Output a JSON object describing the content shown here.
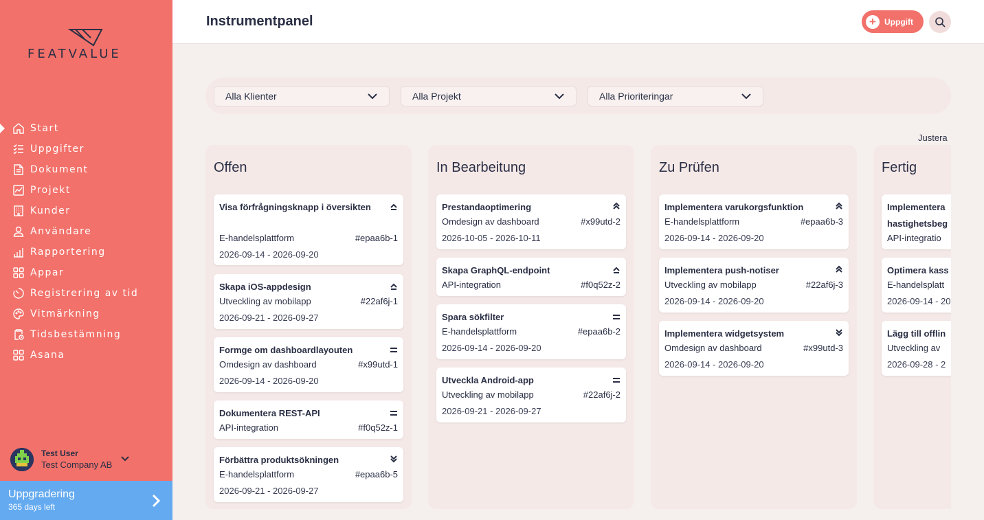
{
  "brand": {
    "name": "FEATVALUE",
    "colors": {
      "primary": "#f2716a",
      "accent": "#64aaf0",
      "text": "#2a2f45"
    }
  },
  "sidebar": {
    "items": [
      {
        "label": "Start",
        "icon": "home-icon",
        "active": true
      },
      {
        "label": "Uppgifter",
        "icon": "checklist-icon"
      },
      {
        "label": "Dokument",
        "icon": "document-icon"
      },
      {
        "label": "Projekt",
        "icon": "chart-icon"
      },
      {
        "label": "Kunder",
        "icon": "building-icon"
      },
      {
        "label": "Användare",
        "icon": "user-icon"
      },
      {
        "label": "Rapportering",
        "icon": "bar-chart-icon"
      },
      {
        "label": "Appar",
        "icon": "apps-icon"
      },
      {
        "label": "Registrering av tid",
        "icon": "timer-icon"
      },
      {
        "label": "Vitmärkning",
        "icon": "palette-icon"
      },
      {
        "label": "Tidsbestämning",
        "icon": "clipboard-clock-icon"
      },
      {
        "label": "Asana",
        "icon": "apps-icon"
      }
    ],
    "user": {
      "name": "Test User",
      "company": "Test Company AB"
    },
    "upgrade": {
      "title": "Uppgradering",
      "subtitle": "365 days left"
    }
  },
  "header": {
    "title": "Instrumentpanel",
    "task_button": "Uppgift"
  },
  "filters": [
    {
      "label": "Alla Klienter"
    },
    {
      "label": "Alla Projekt"
    },
    {
      "label": "Alla Prioriteringar"
    }
  ],
  "adjust_label": "Justera",
  "columns": [
    {
      "title": "Offen",
      "cards": [
        {
          "title": "Visa förfrågningsknapp i översikten",
          "project": "E-handelsplattform",
          "code": "#epaa6b-1",
          "dates": "2026-09-14 - 2026-09-20",
          "priority": "high"
        },
        {
          "title": "Skapa iOS-appdesign",
          "project": "Utveckling av mobilapp",
          "code": "#22af6j-1",
          "dates": "2026-09-21 - 2026-09-27",
          "priority": "high"
        },
        {
          "title": "Formge om dashboardlayouten",
          "project": "Omdesign av dashboard",
          "code": "#x99utd-1",
          "dates": "2026-09-14 - 2026-09-20",
          "priority": "medium"
        },
        {
          "title": "Dokumentera REST-API",
          "project": "API-integration",
          "code": "#f0q52z-1",
          "dates": "",
          "priority": "medium"
        },
        {
          "title": "Förbättra produktsökningen",
          "project": "E-handelsplattform",
          "code": "#epaa6b-5",
          "dates": "2026-09-21 - 2026-09-27",
          "priority": "lowest"
        }
      ]
    },
    {
      "title": "In Bearbeitung",
      "cards": [
        {
          "title": "Prestandaoptimering",
          "project": "Omdesign av dashboard",
          "code": "#x99utd-2",
          "dates": "2026-10-05 - 2026-10-11",
          "priority": "highest"
        },
        {
          "title": "Skapa GraphQL-endpoint",
          "project": "API-integration",
          "code": "#f0q52z-2",
          "dates": "",
          "priority": "high"
        },
        {
          "title": "Spara sökfilter",
          "project": "E-handelsplattform",
          "code": "#epaa6b-2",
          "dates": "2026-09-14 - 2026-09-20",
          "priority": "medium"
        },
        {
          "title": "Utveckla Android-app",
          "project": "Utveckling av mobilapp",
          "code": "#22af6j-2",
          "dates": "2026-09-21 - 2026-09-27",
          "priority": "medium"
        }
      ]
    },
    {
      "title": "Zu Prüfen",
      "cards": [
        {
          "title": "Implementera varukorgsfunktion",
          "project": "E-handelsplattform",
          "code": "#epaa6b-3",
          "dates": "2026-09-14 - 2026-09-20",
          "priority": "highest"
        },
        {
          "title": "Implementera push-notiser",
          "project": "Utveckling av mobilapp",
          "code": "#22af6j-3",
          "dates": "2026-09-14 - 2026-09-20",
          "priority": "highest"
        },
        {
          "title": "Implementera widgetsystem",
          "project": "Omdesign av dashboard",
          "code": "#x99utd-3",
          "dates": "2026-09-14 - 2026-09-20",
          "priority": "lowest"
        }
      ]
    },
    {
      "title": "Fertig",
      "cards": [
        {
          "title": "Implementera hastighetsbeg",
          "project": "API-integratio",
          "code": "",
          "dates": "",
          "priority": ""
        },
        {
          "title": "Optimera kass",
          "project": "E-handelsplatt",
          "code": "",
          "dates": "2026-09-14 - 20",
          "priority": ""
        },
        {
          "title": "Lägg till offlin",
          "project": "Utveckling av",
          "code": "",
          "dates": "2026-09-28 - 2",
          "priority": ""
        }
      ]
    }
  ]
}
